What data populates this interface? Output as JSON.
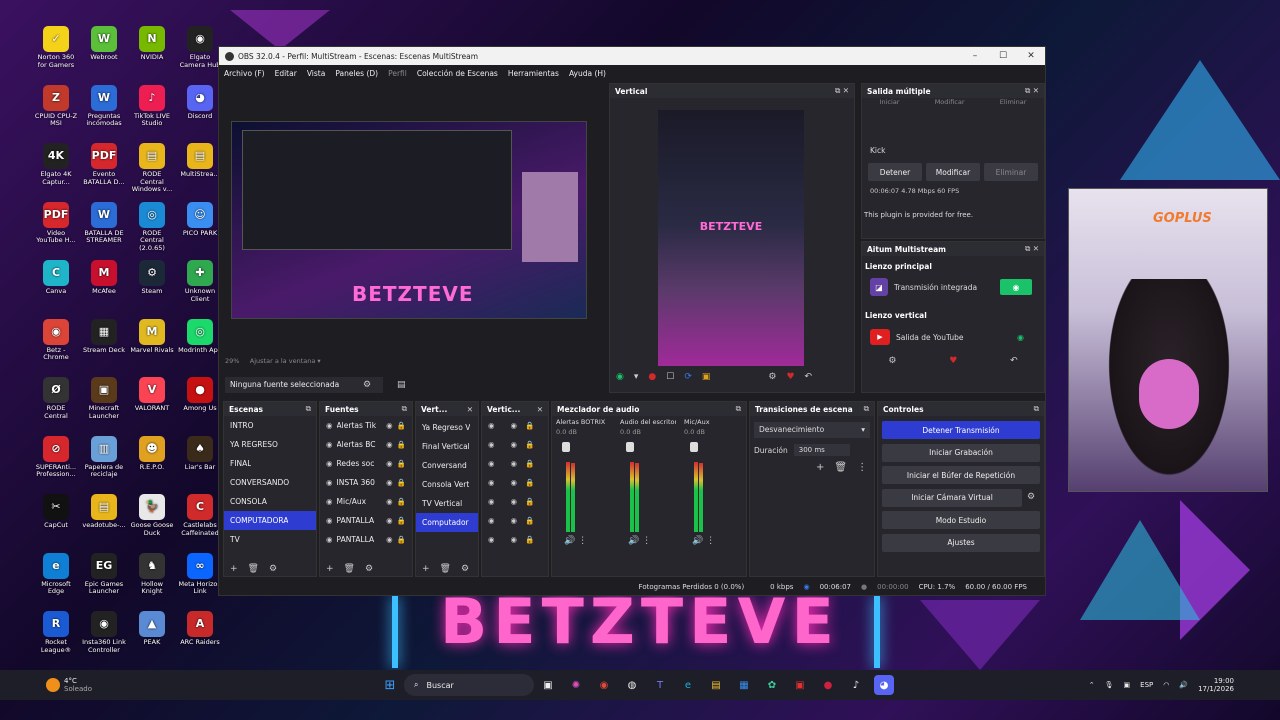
{
  "desktop_icons": [
    {
      "label": "Norton 360 for Gamers",
      "color": "#f4d21a",
      "glyph": "✓"
    },
    {
      "label": "Webroot",
      "color": "#5bbf3a",
      "glyph": "W"
    },
    {
      "label": "NVIDIA",
      "color": "#76b900",
      "glyph": "N"
    },
    {
      "label": "Elgato Camera Hub",
      "color": "#222",
      "glyph": "◉"
    },
    {
      "label": "CPUID CPU-Z MSI",
      "color": "#c0392b",
      "glyph": "Z"
    },
    {
      "label": "Preguntas incómodas",
      "color": "#2b6cd6",
      "glyph": "W"
    },
    {
      "label": "TikTok LIVE Studio",
      "color": "#ee1d52",
      "glyph": "♪"
    },
    {
      "label": "Discord",
      "color": "#5865f2",
      "glyph": "◕"
    },
    {
      "label": "Elgato 4K Captur...",
      "color": "#222",
      "glyph": "4K"
    },
    {
      "label": "Evento BATALLA D...",
      "color": "#d6272d",
      "glyph": "PDF"
    },
    {
      "label": "RODE Central Windows v...",
      "color": "#e8b51a",
      "glyph": "▤"
    },
    {
      "label": "MultiStrea...",
      "color": "#e8b51a",
      "glyph": "▤"
    },
    {
      "label": "Video YouTube H...",
      "color": "#d6272d",
      "glyph": "PDF"
    },
    {
      "label": "BATALLA DE STREAMER",
      "color": "#2b6cd6",
      "glyph": "W"
    },
    {
      "label": "RODE Central (2.0.65)",
      "color": "#1a8ad4",
      "glyph": "◎"
    },
    {
      "label": "PICO PARK",
      "color": "#3a8ef0",
      "glyph": "☺"
    },
    {
      "label": "Canva",
      "color": "#1fb5c9",
      "glyph": "C"
    },
    {
      "label": "McAfee",
      "color": "#c8102e",
      "glyph": "M"
    },
    {
      "label": "Steam",
      "color": "#1b2838",
      "glyph": "⚙"
    },
    {
      "label": "Unknown Client",
      "color": "#2fa84f",
      "glyph": "✚"
    },
    {
      "label": "Betz - Chrome",
      "color": "#db4437",
      "glyph": "◉"
    },
    {
      "label": "Stream Deck",
      "color": "#222",
      "glyph": "▦"
    },
    {
      "label": "Marvel Rivals",
      "color": "#e0b820",
      "glyph": "M"
    },
    {
      "label": "Modrinth App",
      "color": "#1bd96a",
      "glyph": "◎"
    },
    {
      "label": "RODE Central",
      "color": "#333",
      "glyph": "Ø"
    },
    {
      "label": "Minecraft Launcher",
      "color": "#5a3a1a",
      "glyph": "▣"
    },
    {
      "label": "VALORANT",
      "color": "#fa4454",
      "glyph": "V"
    },
    {
      "label": "Among Us",
      "color": "#c51111",
      "glyph": "●"
    },
    {
      "label": "SUPERAnti... Profession...",
      "color": "#d6272d",
      "glyph": "⊘"
    },
    {
      "label": "Papelera de reciclaje",
      "color": "#6aa0d8",
      "glyph": "▥"
    },
    {
      "label": "R.E.P.O.",
      "color": "#e0a020",
      "glyph": "☻"
    },
    {
      "label": "Liar's Bar",
      "color": "#3a2a1a",
      "glyph": "♠"
    },
    {
      "label": "CapCut",
      "color": "#111",
      "glyph": "✂"
    },
    {
      "label": "veadotube-...",
      "color": "#e8b51a",
      "glyph": "▤"
    },
    {
      "label": "Goose Goose Duck",
      "color": "#e8e8e8",
      "glyph": "🦆"
    },
    {
      "label": "Castlelabs Caffeinated",
      "color": "#d02a2a",
      "glyph": "C"
    },
    {
      "label": "Microsoft Edge",
      "color": "#0f7fd6",
      "glyph": "e"
    },
    {
      "label": "Epic Games Launcher",
      "color": "#222",
      "glyph": "EG"
    },
    {
      "label": "Hollow Knight",
      "color": "#333",
      "glyph": "♞"
    },
    {
      "label": "Meta Horizon Link",
      "color": "#0a66ff",
      "glyph": "∞"
    },
    {
      "label": "Rocket League®",
      "color": "#1a5bd4",
      "glyph": "R"
    },
    {
      "label": "Insta360 Link Controller",
      "color": "#222",
      "glyph": "◉"
    },
    {
      "label": "PEAK",
      "color": "#5a8ad4",
      "glyph": "▲"
    },
    {
      "label": "ARC Raiders",
      "color": "#c82a2a",
      "glyph": "A"
    }
  ],
  "obs": {
    "window_title": "OBS 32.0.4 - Perfil: MultiStream - Escenas: Escenas MultiStream",
    "menu": [
      "Archivo (F)",
      "Editar",
      "Vista",
      "Paneles (D)",
      "Perfil",
      "Colección de Escenas",
      "Herramientas",
      "Ayuda (H)"
    ],
    "preview_name": "BETZTEVE",
    "zoom_label": "29%",
    "zoom_option": "Ajustar a la ventana",
    "no_source": "Ninguna fuente seleccionada",
    "vertical_title": "Vertical",
    "salida": {
      "title": "Salida múltiple",
      "top_buttons": [
        "Iniciar",
        "Modificar",
        "Eliminar"
      ],
      "target": "Kick",
      "buttons": [
        "Detener",
        "Modificar",
        "Eliminar"
      ],
      "stats": "00:06:07  4.78 Mbps  60 FPS",
      "plugin_note": "This plugin is provided for free."
    },
    "aitum": {
      "title": "Aitum Multistream",
      "main_canvas": "Lienzo principal",
      "main_output": "Transmisión integrada",
      "vertical_canvas": "Lienzo vertical",
      "vertical_output": "Salida de YouTube"
    },
    "scenes": {
      "title": "Escenas",
      "items": [
        "INTRO",
        "YA REGRESO",
        "FINAL",
        "CONVERSANDO",
        "CONSOLA",
        "COMPUTADORA",
        "TV"
      ],
      "selected": 5
    },
    "sources": {
      "title": "Fuentes",
      "items": [
        "Alertas Tik",
        "Alertas BC",
        "Redes soc",
        "INSTA 360",
        "Mic/Aux",
        "PANTALLA",
        "PANTALLA"
      ]
    },
    "vert_scenes": {
      "title": "Vert...",
      "items": [
        "Ya Regreso V",
        "Final Vertical",
        "Conversand",
        "Consola Vert",
        "TV Vertical",
        "Computador"
      ],
      "selected": 5
    },
    "vert_sources": {
      "title": "Vertic..."
    },
    "mixer": {
      "title": "Mezclador de audio",
      "channels": [
        {
          "name": "Alertas BOTRIX",
          "db": "0.0 dB"
        },
        {
          "name": "Audio del escritorio",
          "db": "0.0 dB"
        },
        {
          "name": "Mic/Aux",
          "db": "0.0 dB"
        }
      ]
    },
    "transitions": {
      "title": "Transiciones de escena",
      "selected": "Desvanecimiento",
      "duration_label": "Duración",
      "duration_value": "300 ms"
    },
    "controls": {
      "title": "Controles",
      "buttons": [
        "Detener Transmisión",
        "Iniciar Grabación",
        "Iniciar el Búfer de Repetición",
        "Iniciar Cámara Virtual",
        "Modo Estudio",
        "Ajustes"
      ]
    },
    "status": {
      "dropped": "Fotogramas Perdidos 0 (0.0%)",
      "kbps": "0 kbps",
      "stream_time": "00:06:07",
      "rec_time": "00:00:00",
      "cpu": "CPU: 1.7%",
      "fps": "60.00 / 60.00 FPS"
    }
  },
  "overlay_text": "BETZTEVE",
  "webcam_logo": "GOPLUS",
  "taskbar": {
    "weather_temp": "4°C",
    "weather_desc": "Soleado",
    "search": "Buscar",
    "lang": "ESP",
    "time": "19:00",
    "date": "17/1/2026"
  }
}
